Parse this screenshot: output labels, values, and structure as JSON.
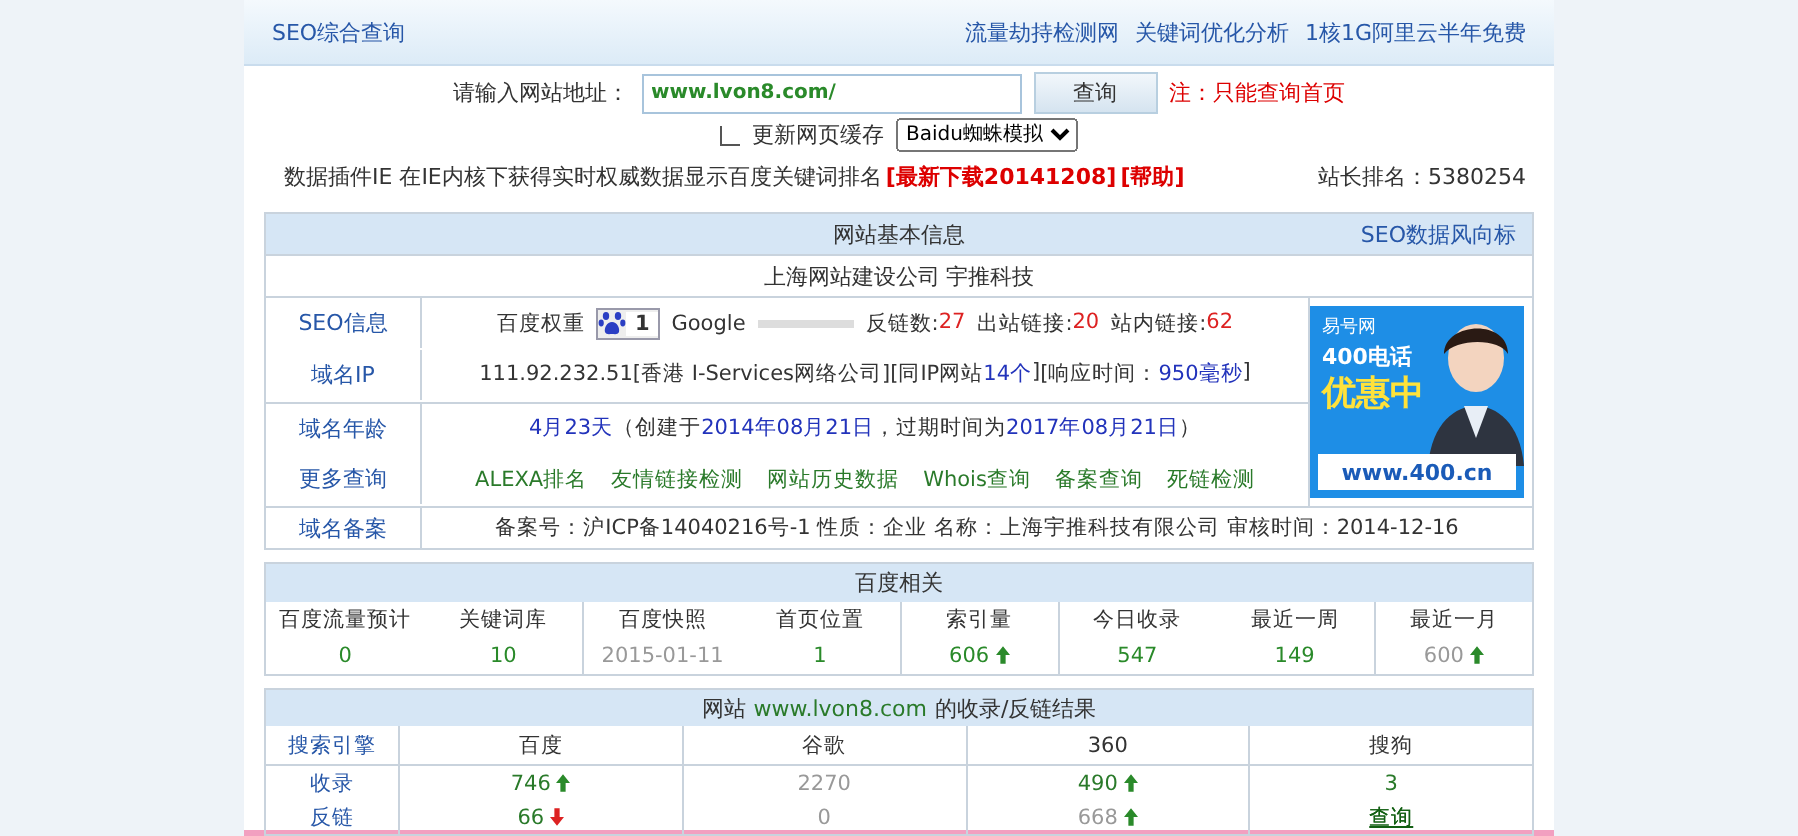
{
  "header": {
    "title": "SEO综合查询",
    "links": [
      "流量劫持检测网",
      "关键词优化分析",
      "1核1G阿里云半年免费"
    ]
  },
  "form": {
    "label": "请输入网站地址：",
    "value": "www.lvon8.com/",
    "button": "查询",
    "note": "注：只能查询首页",
    "cache": {
      "label": "更新网页缓存",
      "checked": false
    },
    "select": "Baidu蜘蛛模拟",
    "plugin_text": "数据插件IE 在IE内核下获得实时权威数据显示百度关键词排名",
    "download": "[最新下载20141208]",
    "help": "[帮助]",
    "rank": "站长排名：5380254"
  },
  "info": {
    "title": "网站基本信息",
    "side_link": "SEO数据风向标",
    "site_title": "上海网站建设公司 宇推科技",
    "seo": {
      "label": "SEO信息",
      "baidu_label": "百度权重",
      "baidu_weight": "1",
      "google_label": "Google",
      "google_pr": {
        "level": 0
      },
      "stats": [
        {
          "label": "反链数:",
          "value": "27"
        },
        {
          "label": "出站链接:",
          "value": "20"
        },
        {
          "label": "站内链接:",
          "value": "62"
        }
      ]
    },
    "ip": {
      "label": "域名IP",
      "parts": [
        {
          "text": "111.92.232.51[香港 I-Services网络公司]",
          "link": false
        },
        {
          "text": "[同IP网站",
          "link": false
        },
        {
          "text": "14个",
          "link": true
        },
        {
          "text": "]",
          "link": false
        },
        {
          "text": "[响应时间：",
          "link": false
        },
        {
          "text": "950毫秒",
          "link": true
        },
        {
          "text": "]",
          "link": false
        }
      ]
    },
    "age": {
      "label": "域名年龄",
      "parts": [
        {
          "text": "4月23天",
          "link": true
        },
        {
          "text": "（创建于",
          "link": false
        },
        {
          "text": "2014年08月21日",
          "link": true
        },
        {
          "text": "，过期时间为",
          "link": false
        },
        {
          "text": "2017年08月21日",
          "link": true
        },
        {
          "text": "）",
          "link": false
        }
      ]
    },
    "more": {
      "label": "更多查询",
      "links": [
        "ALEXA排名",
        "友情链接检测",
        "网站历史数据",
        "Whois查询",
        "备案查询",
        "死链检测"
      ]
    },
    "icp": {
      "label": "域名备案",
      "text": "备案号：沪ICP备14040216号-1 性质：企业 名称：上海宇推科技有限公司 审核时间：2014-12-16"
    },
    "ad": {
      "brand": "易号网",
      "line1": "400电话",
      "line2": "优惠中",
      "url": "www.400.cn"
    }
  },
  "baidu": {
    "title": "百度相关",
    "columns": [
      {
        "head": "百度流量预计",
        "value": "0",
        "muted": false,
        "up": false,
        "down": false
      },
      {
        "head": "关键词库",
        "value": "10",
        "muted": false,
        "up": false,
        "down": false
      },
      {
        "head": "百度快照",
        "value": "2015-01-11",
        "muted": true,
        "up": false,
        "down": false
      },
      {
        "head": "首页位置",
        "value": "1",
        "muted": false,
        "up": false,
        "down": false
      },
      {
        "head": "索引量",
        "value": "606",
        "muted": false,
        "up": true,
        "down": false
      },
      {
        "head": "今日收录",
        "value": "547",
        "muted": false,
        "up": false,
        "down": false
      },
      {
        "head": "最近一周",
        "value": "149",
        "muted": false,
        "up": false,
        "down": false
      },
      {
        "head": "最近一月",
        "value": "600",
        "muted": true,
        "up": true,
        "down": false
      }
    ]
  },
  "results": {
    "title_pre": "网站",
    "title_site": "www.lvon8.com",
    "title_post": "的收录/反链结果",
    "corner": "搜索引擎",
    "columns": [
      "百度",
      "谷歌",
      "360",
      "搜狗"
    ],
    "rows": [
      {
        "label": "收录",
        "cells": [
          {
            "value": "746",
            "muted": false,
            "up": true,
            "down": false,
            "link": false
          },
          {
            "value": "2270",
            "muted": true,
            "up": false,
            "down": false,
            "link": false
          },
          {
            "value": "490",
            "muted": false,
            "up": true,
            "down": false,
            "link": false
          },
          {
            "value": "3",
            "muted": false,
            "up": false,
            "down": false,
            "link": false
          }
        ]
      },
      {
        "label": "反链",
        "cells": [
          {
            "value": "66",
            "muted": false,
            "up": false,
            "down": true,
            "link": false
          },
          {
            "value": "0",
            "muted": true,
            "up": false,
            "down": false,
            "link": false
          },
          {
            "value": "668",
            "muted": true,
            "up": true,
            "down": false,
            "link": false
          },
          {
            "value": "查询",
            "muted": false,
            "up": false,
            "down": false,
            "link": true
          }
        ]
      }
    ]
  }
}
